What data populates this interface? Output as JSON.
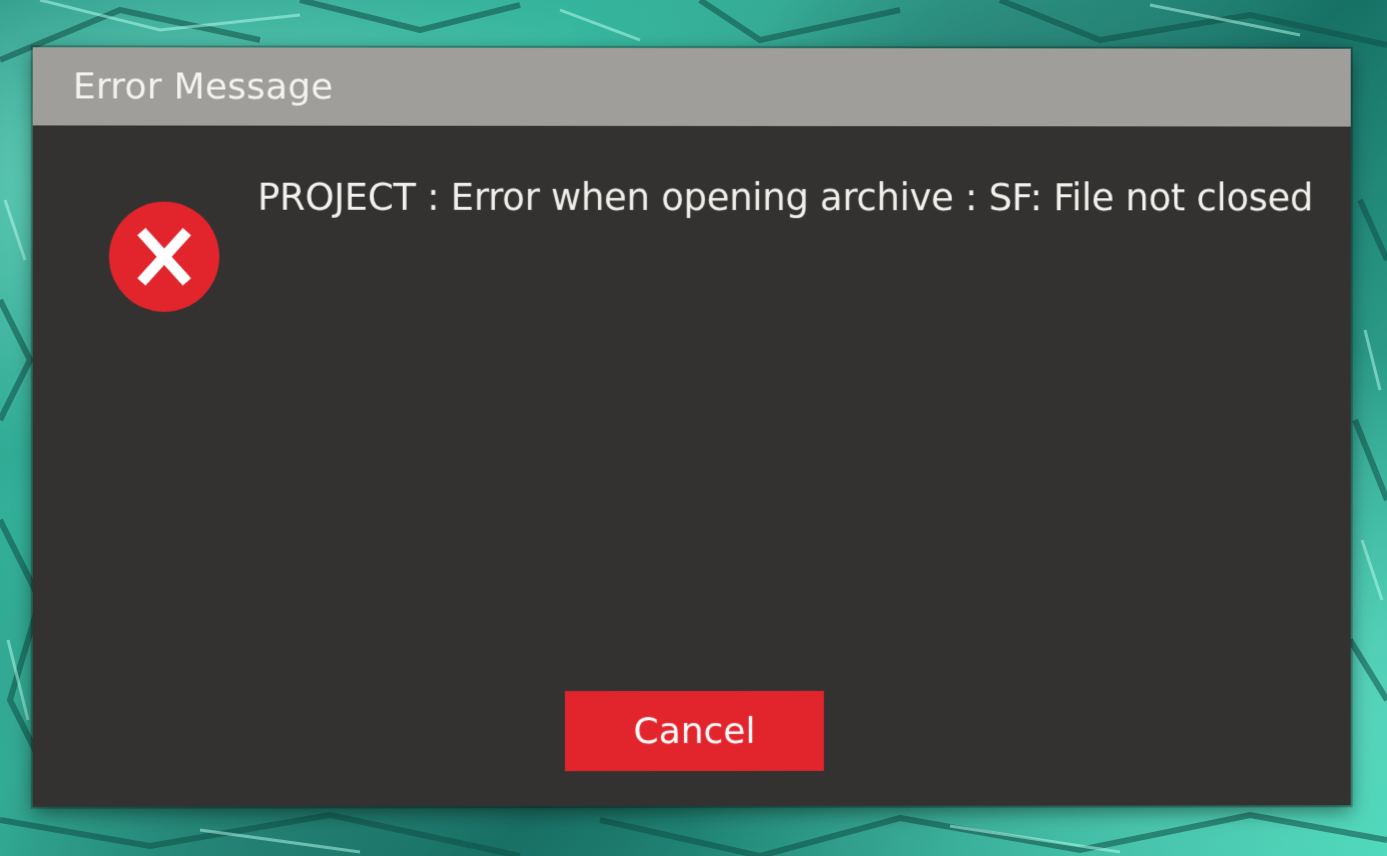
{
  "dialog": {
    "title": "Error Message",
    "icon": "error-icon",
    "message": "PROJECT : Error when opening archive : SF: File not closed",
    "cancel_label": "Cancel"
  },
  "colors": {
    "title_bar": "#a09e9b",
    "dialog_body": "#333231",
    "error_red": "#e2252c",
    "wallpaper": "#2fb39a"
  }
}
